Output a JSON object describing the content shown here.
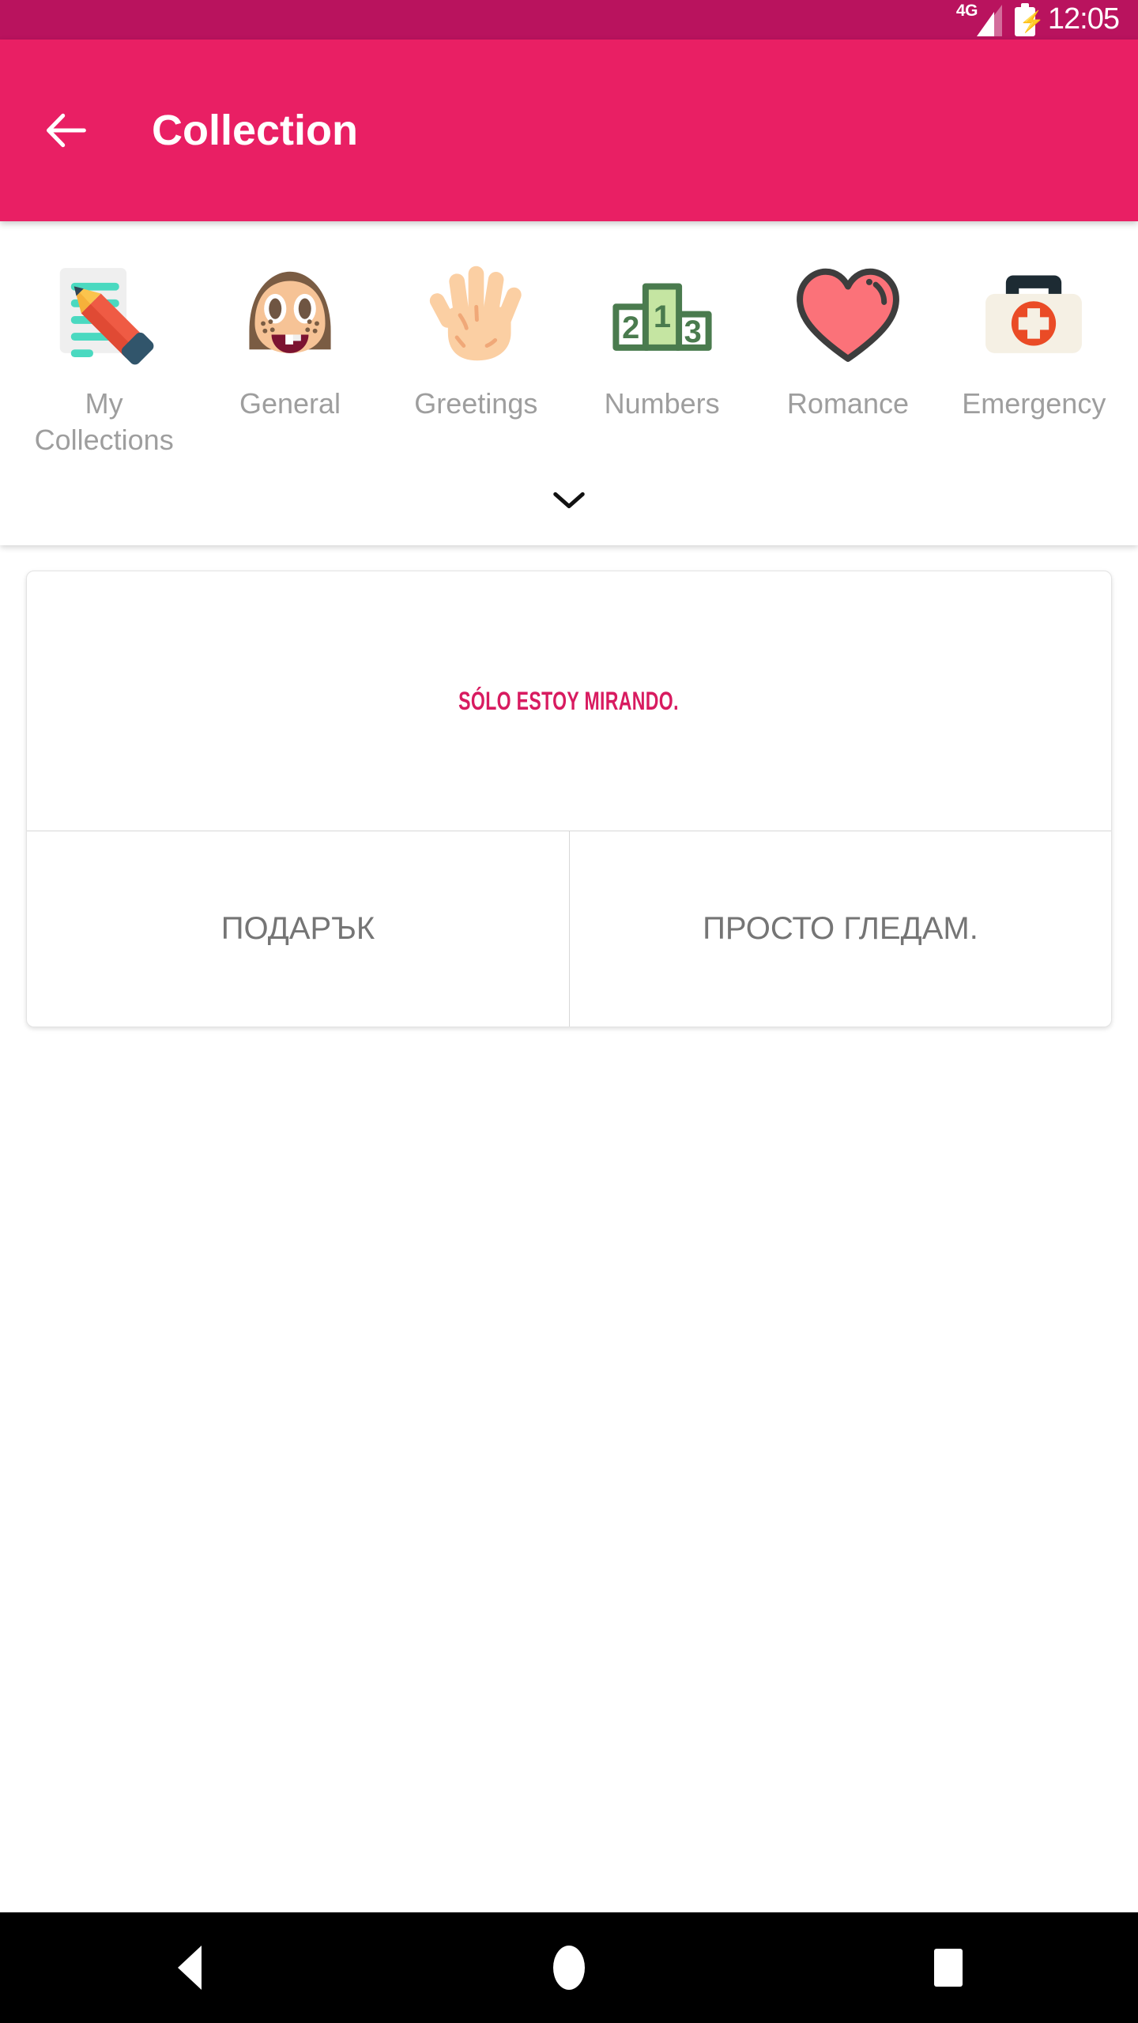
{
  "status_bar": {
    "network_label": "4G",
    "time": "12:05",
    "signal_icon": "signal-bars-icon",
    "battery_icon": "battery-charging-icon",
    "background_color": "#b9135e"
  },
  "app_bar": {
    "back_icon": "back-arrow-icon",
    "title": "Collection",
    "background_color": "#e91f64",
    "title_color": "#ffffff"
  },
  "categories": {
    "expand_icon": "chevron-down-icon",
    "label_color": "#9e9e9e",
    "items": [
      {
        "label": "My Collections",
        "icon": "note-pencil-icon"
      },
      {
        "label": "General",
        "icon": "girl-face-emoji-icon"
      },
      {
        "label": "Greetings",
        "icon": "open-hand-emoji-icon"
      },
      {
        "label": "Numbers",
        "icon": "podium-123-icon"
      },
      {
        "label": "Romance",
        "icon": "heart-icon"
      },
      {
        "label": "Emergency",
        "icon": "first-aid-kit-icon"
      }
    ]
  },
  "phrase_card": {
    "phrase": "SÓLO ESTOY MIRANDO.",
    "phrase_color": "#d81b60",
    "actions": [
      {
        "label": "ПОДАРЪК"
      },
      {
        "label": "ПРОСТО ГЛЕДАМ."
      }
    ],
    "action_color": "#757575"
  },
  "nav_bar": {
    "background_color": "#000000",
    "buttons": [
      {
        "icon": "android-back-icon"
      },
      {
        "icon": "android-home-icon"
      },
      {
        "icon": "android-recents-icon"
      }
    ]
  }
}
